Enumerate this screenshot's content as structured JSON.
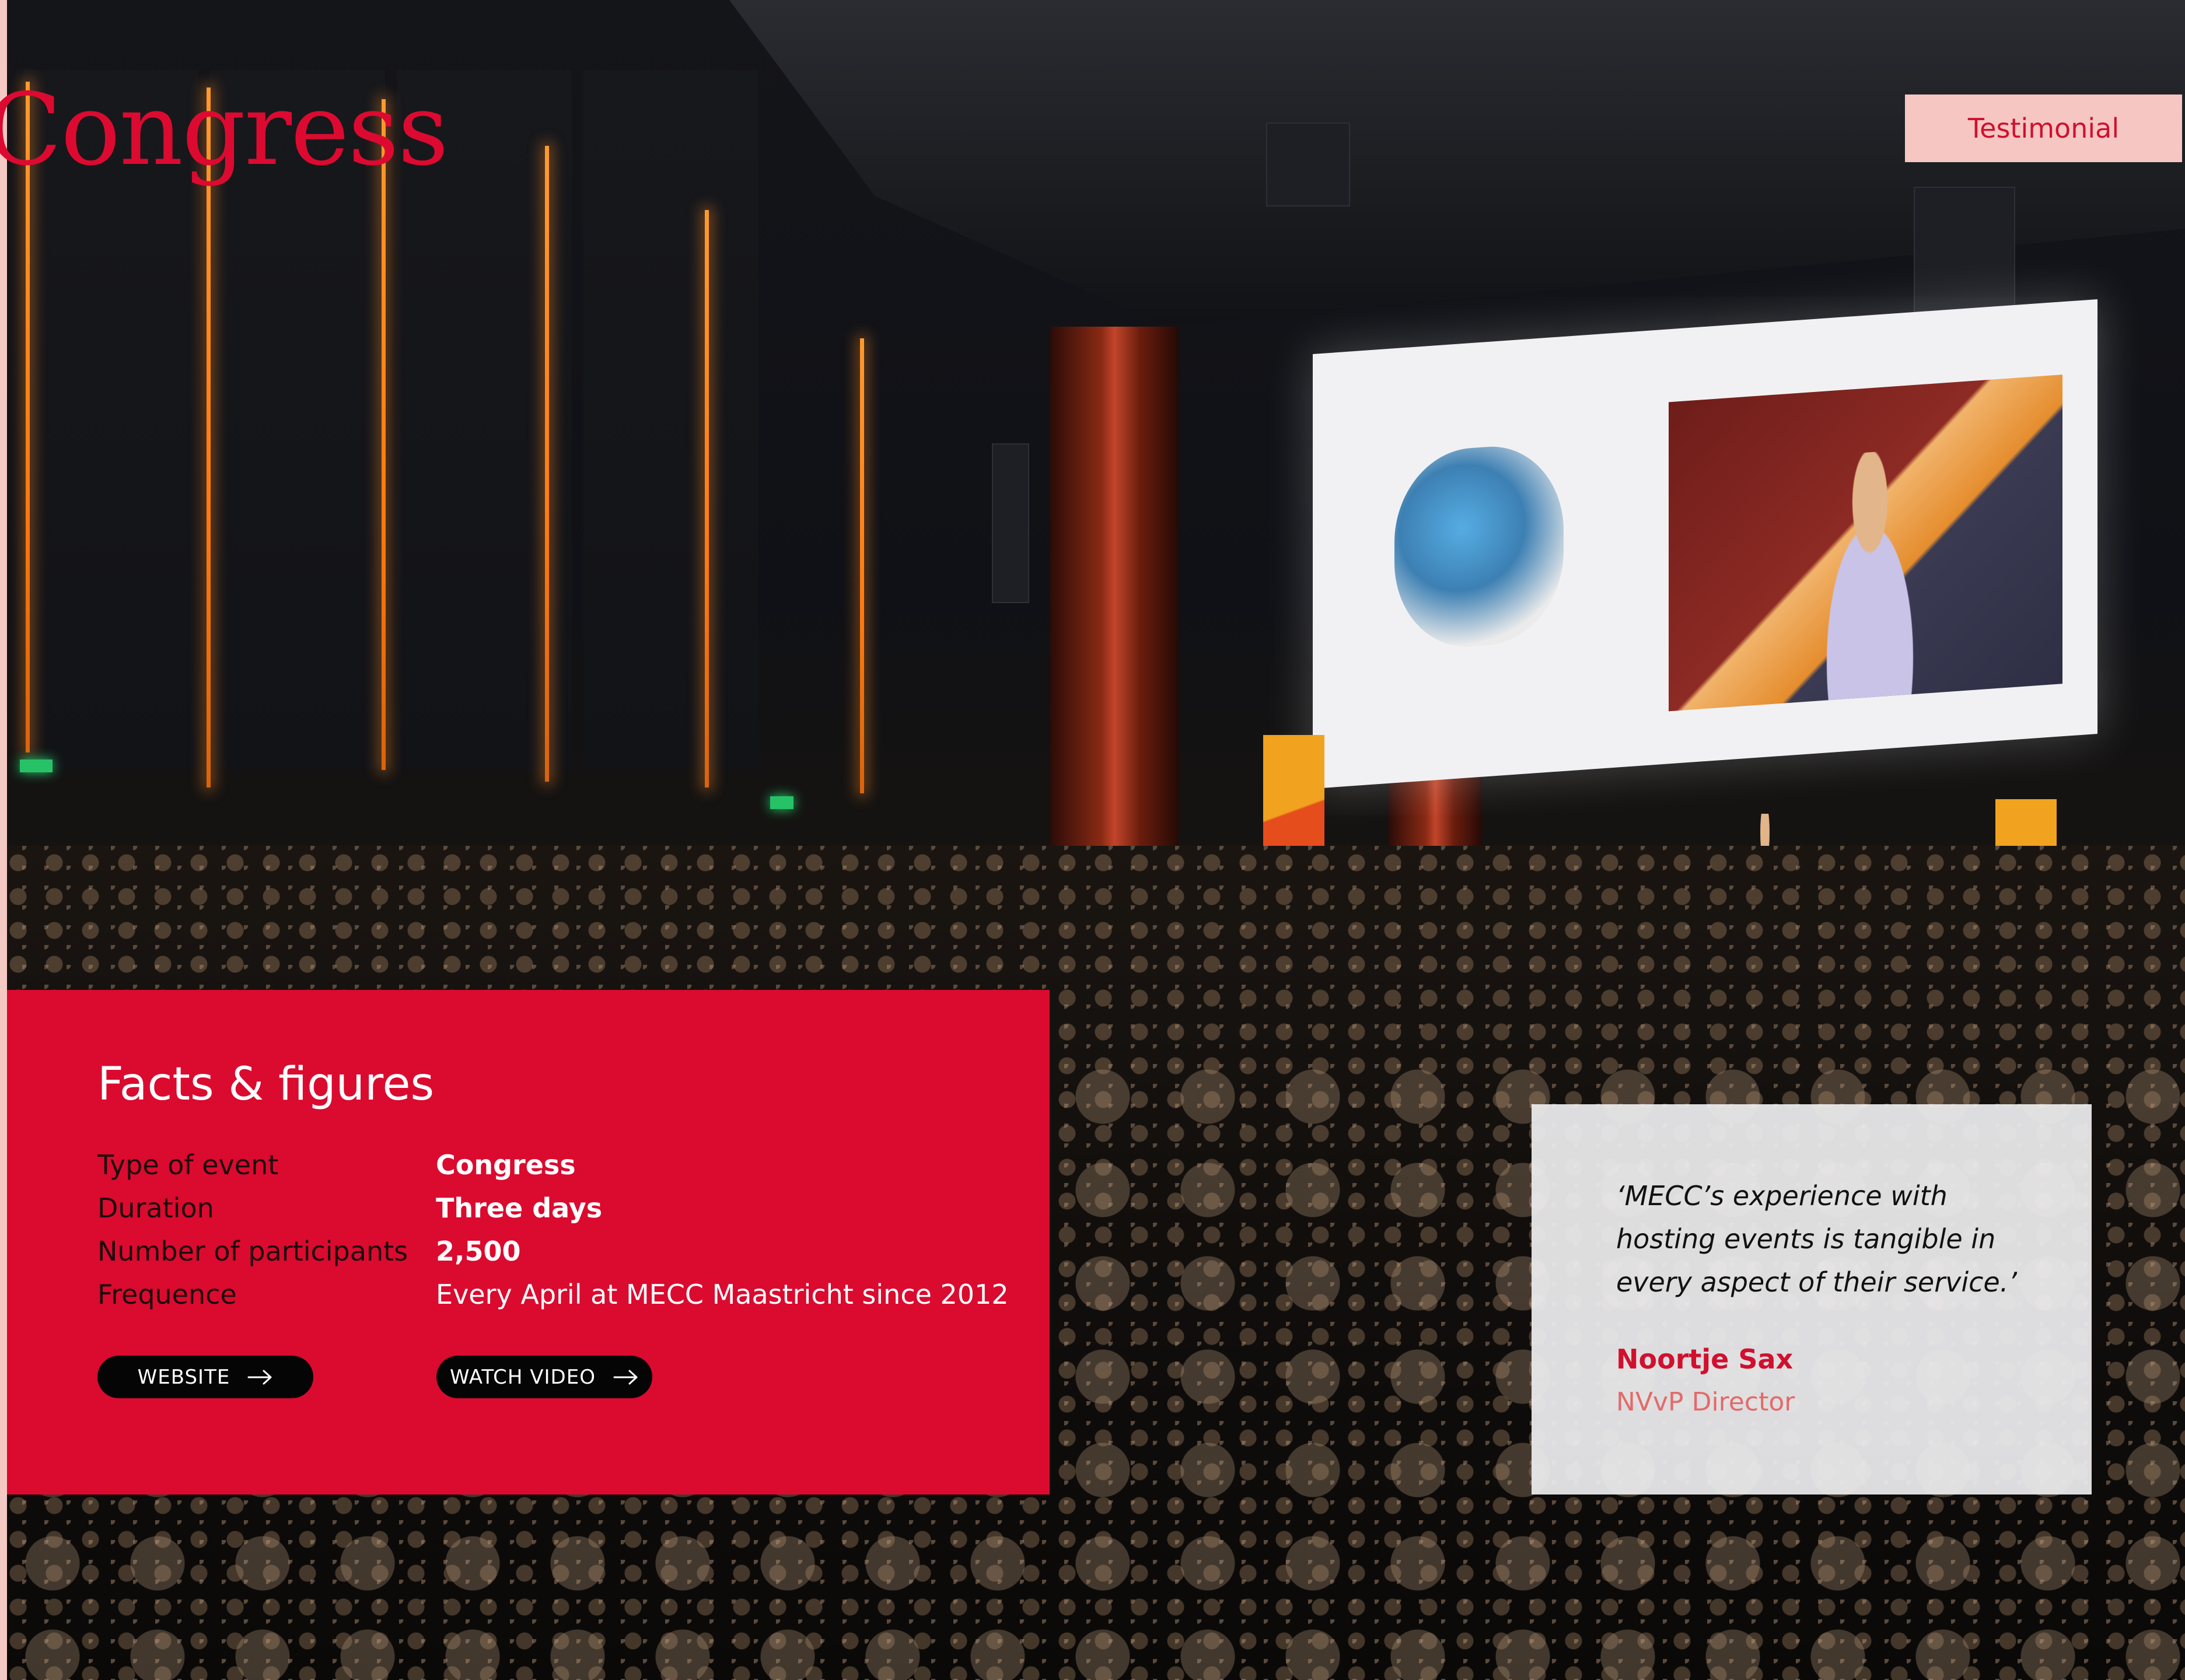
{
  "header": {
    "title": "Congress",
    "badge": "Testimonial"
  },
  "facts": {
    "title": "Facts & figures",
    "rows": [
      {
        "label": "Type of event",
        "value": "Congress"
      },
      {
        "label": "Duration",
        "value": "Three days"
      },
      {
        "label": "Number of participants",
        "value": "2,500"
      },
      {
        "label": "Frequence",
        "value": "Every April at MECC Maastricht since 2012"
      }
    ],
    "buttons": {
      "website": "WEBSITE",
      "watch_video": "WATCH VIDEO"
    }
  },
  "testimonial": {
    "quote": "‘MECC’s experience with hosting events is tangible in every aspect of their service.’",
    "name": "Noortje Sax",
    "role": "NVvP Director"
  },
  "icons": {
    "button_arrow": "arrow-right-icon"
  },
  "colors": {
    "brand_red": "#db0a2f",
    "badge_pink": "#f5c6c2",
    "button_black": "#050505",
    "quote_card": "#edebef",
    "role_coral": "#e36a6a"
  }
}
